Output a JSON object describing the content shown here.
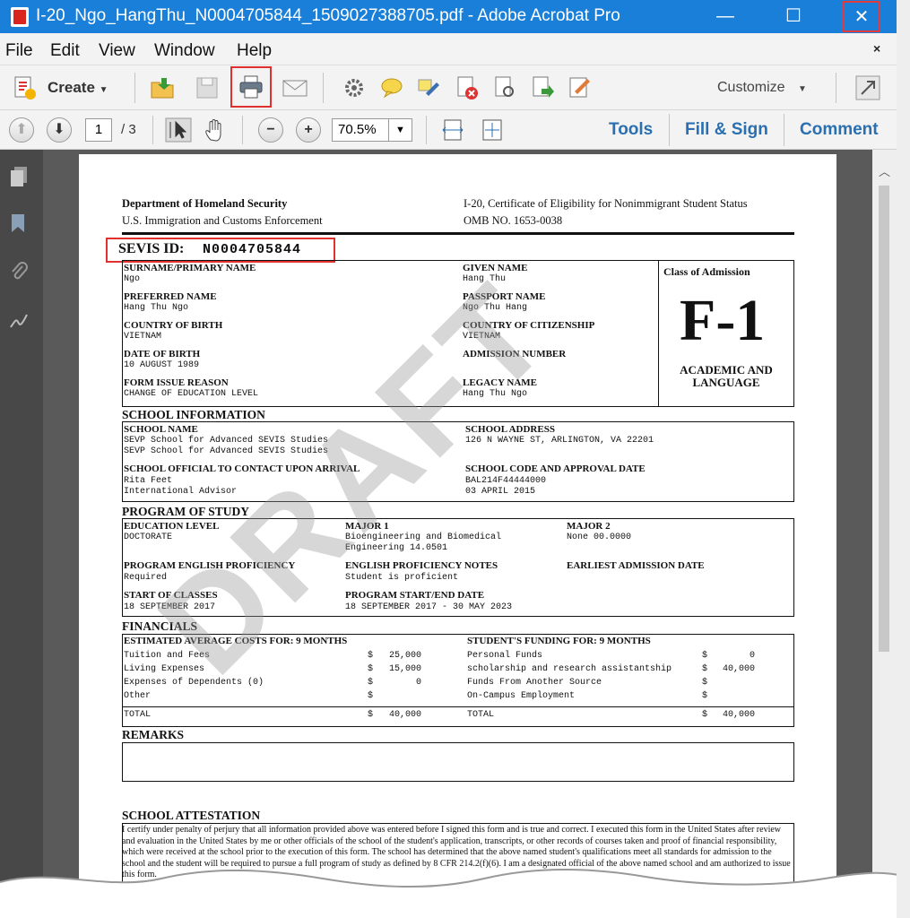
{
  "window": {
    "title": "I-20_Ngo_HangThu_N0004705844_1509027388705.pdf - Adobe Acrobat Pro",
    "minimize_icon": "—",
    "maximize_icon": "☐",
    "close_icon": "✕"
  },
  "menu": [
    "File",
    "Edit",
    "View",
    "Window",
    "Help"
  ],
  "menu_close": "×",
  "toolbar": {
    "create_label": "Create",
    "customize_label": "Customize",
    "page_current": "1",
    "page_total": "/ 3",
    "zoom": "70.5%",
    "tools_label": "Tools",
    "fill_sign_label": "Fill & Sign",
    "comment_label": "Comment"
  },
  "doc": {
    "header_left_1": "Department of Homeland Security",
    "header_left_2": "U.S. Immigration and Customs Enforcement",
    "header_right_1": "I-20, Certificate of Eligibility for Nonimmigrant Student Status",
    "header_right_2": "OMB NO. 1653-0038",
    "sevis_label": "SEVIS ID:",
    "sevis_value": "N0004705844",
    "personal": {
      "surname_label": "SURNAME/PRIMARY NAME",
      "surname": "Ngo",
      "given_label": "GIVEN NAME",
      "given": "Hang Thu",
      "preferred_label": "PREFERRED NAME",
      "preferred": "Hang Thu Ngo",
      "passport_label": "PASSPORT NAME",
      "passport": "Ngo Thu Hang",
      "cob_label": "COUNTRY OF BIRTH",
      "cob": "VIETNAM",
      "coc_label": "COUNTRY OF CITIZENSHIP",
      "coc": "VIETNAM",
      "dob_label": "DATE OF BIRTH",
      "dob": "10 AUGUST 1989",
      "admission_label": "ADMISSION NUMBER",
      "reason_label": "FORM ISSUE REASON",
      "reason": "CHANGE OF EDUCATION LEVEL",
      "legacy_label": "LEGACY NAME",
      "legacy": "Hang Thu Ngo",
      "class_label": "Class of Admission",
      "class_value": "F-1",
      "class_sub_1": "ACADEMIC AND",
      "class_sub_2": "LANGUAGE"
    },
    "school": {
      "section": "SCHOOL INFORMATION",
      "name_label": "SCHOOL NAME",
      "name_1": "SEVP School for Advanced SEVIS Studies",
      "name_2": "SEVP School for Advanced SEVIS Studies",
      "address_label": "SCHOOL ADDRESS",
      "address": "126 N WAYNE ST, ARLINGTON, VA 22201",
      "official_label": "SCHOOL OFFICIAL TO CONTACT UPON ARRIVAL",
      "official_1": "Rita Feet",
      "official_2": "International Advisor",
      "code_label": "SCHOOL CODE AND APPROVAL DATE",
      "code": "BAL214F44444000",
      "approval": "03 APRIL 2015"
    },
    "program": {
      "section": "PROGRAM OF STUDY",
      "edu_label": "EDUCATION LEVEL",
      "edu": "DOCTORATE",
      "major1_label": "MAJOR 1",
      "major1_a": "Bioengineering and Biomedical",
      "major1_b": "Engineering 14.0501",
      "major2_label": "MAJOR 2",
      "major2": "None 00.0000",
      "prof_label": "PROGRAM ENGLISH PROFICIENCY",
      "prof": "Required",
      "notes_label": "ENGLISH PROFICIENCY NOTES",
      "notes": "Student is proficient",
      "earliest_label": "EARLIEST ADMISSION DATE",
      "start_label": "START OF CLASSES",
      "start": "18 SEPTEMBER 2017",
      "startend_label": "PROGRAM START/END DATE",
      "startend": "18 SEPTEMBER 2017 - 30 MAY 2023"
    },
    "financials": {
      "section": "FINANCIALS",
      "costs_label": "ESTIMATED AVERAGE COSTS FOR: 9 MONTHS",
      "funding_label": "STUDENT'S FUNDING FOR: 9 MONTHS",
      "costs": [
        {
          "item": "Tuition and Fees",
          "cur": "$",
          "amt": "25,000"
        },
        {
          "item": "Living Expenses",
          "cur": "$",
          "amt": "15,000"
        },
        {
          "item": "Expenses of Dependents (0)",
          "cur": "$",
          "amt": "0"
        },
        {
          "item": "Other",
          "cur": "$",
          "amt": ""
        }
      ],
      "funding": [
        {
          "item": "Personal Funds",
          "cur": "$",
          "amt": "0"
        },
        {
          "item": "scholarship and research assistantship",
          "cur": "$",
          "amt": "40,000"
        },
        {
          "item": "Funds From Another Source",
          "cur": "$",
          "amt": ""
        },
        {
          "item": "On-Campus Employment",
          "cur": "$",
          "amt": ""
        }
      ],
      "total_label": "TOTAL",
      "total_cost_cur": "$",
      "total_cost": "40,000",
      "total_fund_label": "TOTAL",
      "total_fund_cur": "$",
      "total_fund": "40,000"
    },
    "remarks_section": "REMARKS",
    "attestation_section": "SCHOOL ATTESTATION",
    "attestation_text": "I certify under penalty of perjury that all information provided above was entered before I signed this form and is true and correct. I executed this form in the United States after review and evaluation in the United States by me or other officials of the school of the student's application, transcripts, or other records of courses taken and proof of financial responsibility, which were received at the school prior to the execution of this form. The school has determined that the above named student's qualifications meet all standards for admission to the school and the student will be required to pursue a full program of study as defined by 8 CFR 214.2(f)(6). I am a designated official of the above named school and am authorized to issue this form.",
    "watermark": "DRAFT"
  }
}
